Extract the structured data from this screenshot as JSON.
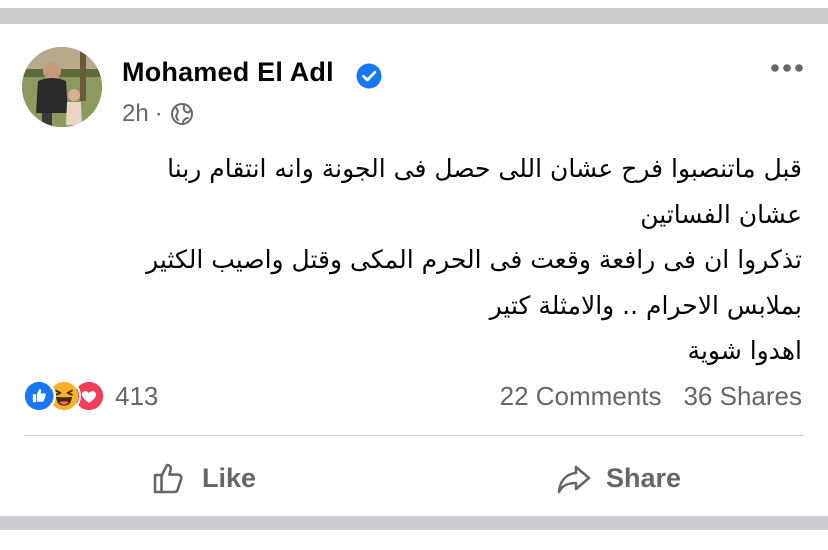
{
  "post": {
    "author": "Mohamed El Adl",
    "verified": true,
    "timestamp": "2h",
    "separator": "·",
    "audience_icon": "globe-icon",
    "body_lines": [
      "قبل ماتنصبوا فرح عشان اللى حصل فى الجونة وانه انتقام ربنا",
      "عشان الفساتين",
      "تذكروا ان فى رافعة وقعت فى الحرم المكى وقتل واصيب الكثير",
      "بملابس الاحرام .. والامثلة كتير",
      "اهدوا شوية"
    ]
  },
  "reactions": {
    "types": [
      "like",
      "haha",
      "love"
    ],
    "count": "413"
  },
  "stats": {
    "comments": "22 Comments",
    "shares": "36 Shares"
  },
  "actions": {
    "like_label": "Like",
    "share_label": "Share"
  },
  "colors": {
    "like_blue": "#1877f2",
    "haha_yellow": "#f7b125",
    "love_red": "#f33e58",
    "secondary_text": "#65676b",
    "separator_gray": "#c9ccd1"
  }
}
